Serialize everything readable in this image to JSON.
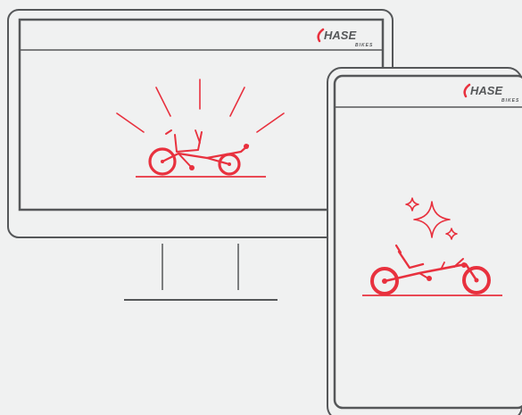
{
  "brand": {
    "logo_word": "HASE",
    "logo_sub": "BIKES",
    "accent_color": "#e8313e",
    "outline_color": "#555759",
    "background_color": "#f0f1f1"
  },
  "desktop": {
    "device": "monitor",
    "illustration": "recumbent-trike-with-burst-rays"
  },
  "mobile": {
    "device": "phone",
    "illustration": "recumbent-bike-with-sparkles"
  }
}
